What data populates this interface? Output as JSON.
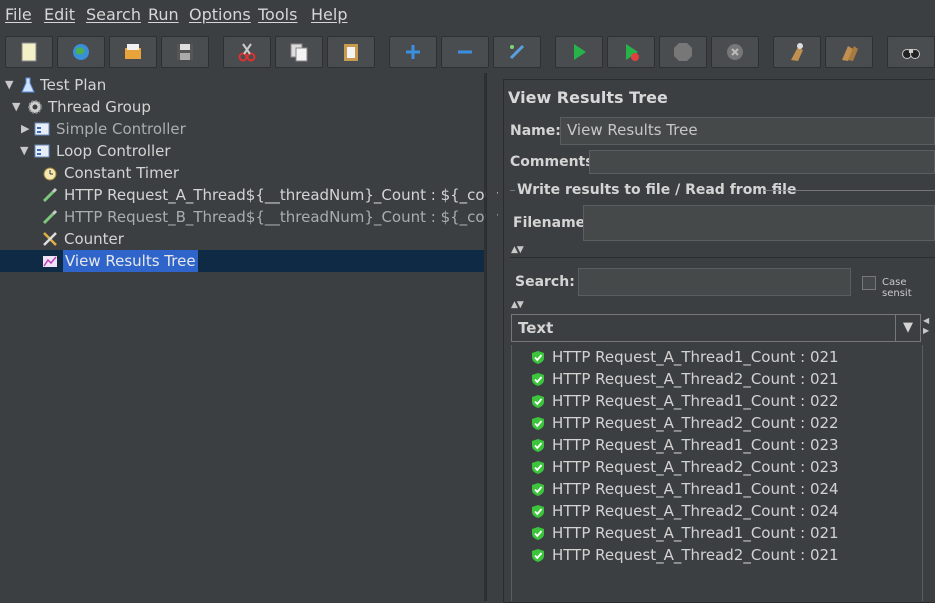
{
  "menu": [
    "File",
    "Edit",
    "Search",
    "Run",
    "Options",
    "Tools",
    "Help"
  ],
  "toolbar": [
    {
      "icon": "new-icon"
    },
    {
      "icon": "templates-icon"
    },
    {
      "icon": "open-icon"
    },
    {
      "icon": "save-icon"
    },
    {
      "icon": "cut-icon"
    },
    {
      "icon": "copy-icon"
    },
    {
      "icon": "paste-icon"
    },
    {
      "icon": "expand-icon"
    },
    {
      "icon": "collapse-icon"
    },
    {
      "icon": "toggle-icon"
    },
    {
      "icon": "start-icon"
    },
    {
      "icon": "start-no-pauses-icon"
    },
    {
      "icon": "stop-icon"
    },
    {
      "icon": "shutdown-icon"
    },
    {
      "icon": "clear-icon"
    },
    {
      "icon": "clear-all-icon"
    },
    {
      "icon": "search-icon"
    }
  ],
  "tree": {
    "items": [
      {
        "label": "Test Plan",
        "icon": "flask-icon"
      },
      {
        "label": "Thread Group",
        "icon": "gear-icon"
      },
      {
        "label": "Simple Controller",
        "icon": "controller-icon"
      },
      {
        "label": "Loop Controller",
        "icon": "controller-icon"
      },
      {
        "label": "Constant Timer",
        "icon": "stopwatch-icon"
      },
      {
        "label": "HTTP Request_A_Thread${__threadNum}_Count : ${_count}",
        "icon": "pipette-icon"
      },
      {
        "label": "HTTP Request_B_Thread${__threadNum}_Count : ${_count}",
        "icon": "pipette-icon"
      },
      {
        "label": "Counter",
        "icon": "tools-icon"
      },
      {
        "label": "View Results Tree",
        "icon": "chart-icon"
      }
    ]
  },
  "panel": {
    "title": "View Results Tree",
    "name_label": "Name:",
    "name_value": "View Results Tree",
    "comments_label": "Comments:",
    "comments_value": "",
    "file_group_label": "Write results to file / Read from file",
    "filename_label": "Filename",
    "filename_value": "",
    "search_label": "Search:",
    "search_value": "",
    "case_sensitive_label": "Case sensit",
    "renderer_value": "Text"
  },
  "results": [
    "HTTP Request_A_Thread1_Count : 021",
    "HTTP Request_A_Thread2_Count : 021",
    "HTTP Request_A_Thread1_Count : 022",
    "HTTP Request_A_Thread2_Count : 022",
    "HTTP Request_A_Thread1_Count : 023",
    "HTTP Request_A_Thread2_Count : 023",
    "HTTP Request_A_Thread1_Count : 024",
    "HTTP Request_A_Thread2_Count : 024",
    "HTTP Request_A_Thread1_Count : 021",
    "HTTP Request_A_Thread2_Count : 021"
  ],
  "colors": {
    "background": "#3c3f41",
    "selection": "#2f65ca",
    "success": "#3cc43c"
  }
}
